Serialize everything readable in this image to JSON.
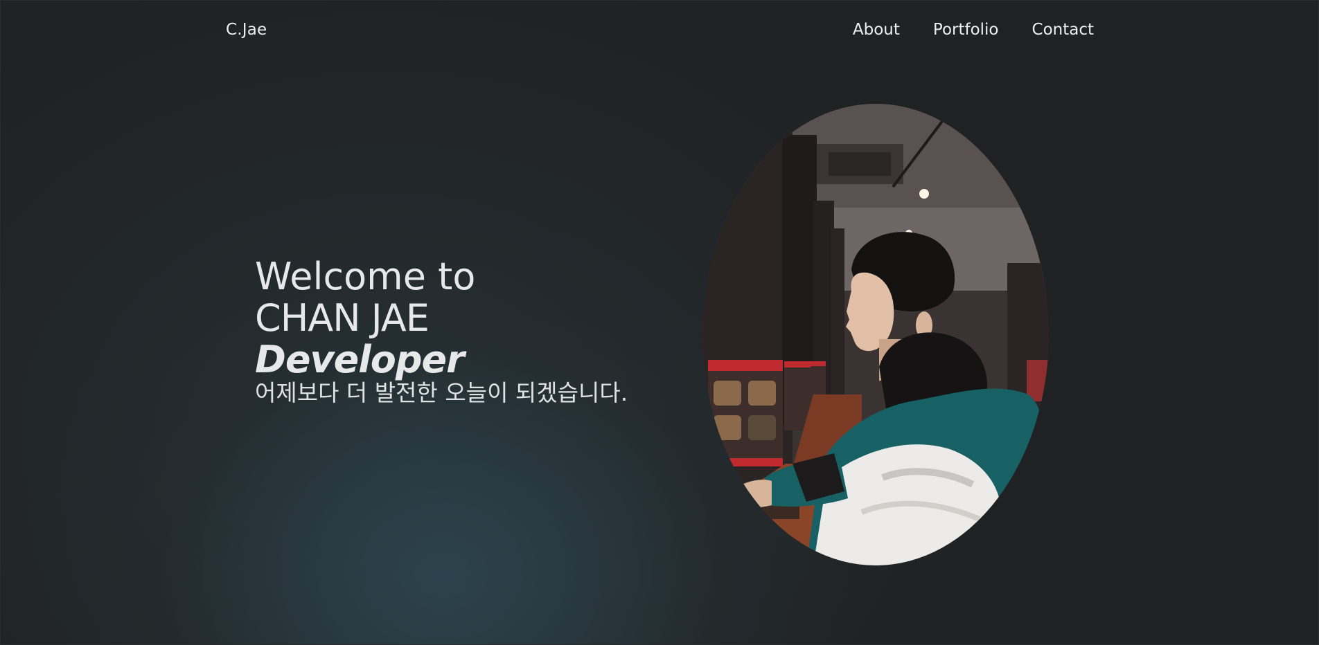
{
  "header": {
    "logo": "C.Jae",
    "nav": [
      {
        "label": "About"
      },
      {
        "label": "Portfolio"
      },
      {
        "label": "Contact"
      }
    ]
  },
  "hero": {
    "line1": "Welcome to",
    "line2": "CHAN JAE",
    "line3": "Developer",
    "tagline": "어제보다 더 발전한 오늘이 되겠습니다."
  },
  "colors": {
    "background": "#202122",
    "glow": "#2e444e",
    "text": "#e8e9eb"
  }
}
